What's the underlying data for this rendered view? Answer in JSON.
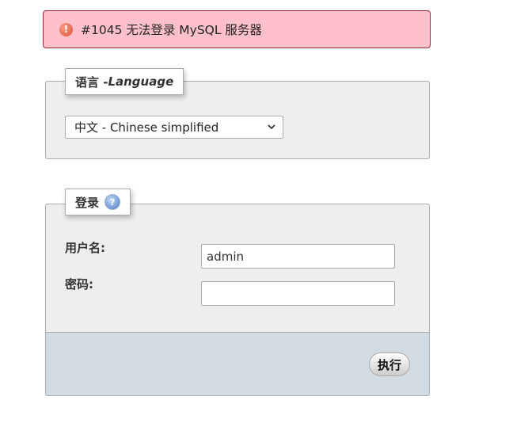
{
  "error": {
    "icon": "error-icon",
    "icon_glyph": "!",
    "message": "#1045 无法登录 MySQL 服务器"
  },
  "language": {
    "legend_prefix": "语言 - ",
    "legend_em": "Language",
    "selected": "中文 - Chinese simplified"
  },
  "login": {
    "legend": "登录",
    "help_icon": "help-icon",
    "help_glyph": "?",
    "username_label": "用户名:",
    "username_value": "admin",
    "password_label": "密码:",
    "password_value": "",
    "submit_label": "执行"
  },
  "colors": {
    "error_bg": "#ffc0cb",
    "panel_bg": "#eeeeee",
    "footer_bg": "#d3dce3"
  }
}
